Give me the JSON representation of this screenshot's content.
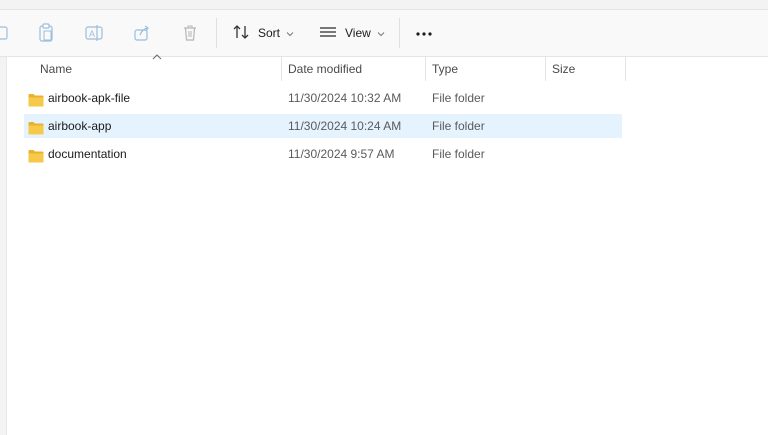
{
  "toolbar": {
    "sort_label": "Sort",
    "view_label": "View",
    "icons": [
      "new-icon",
      "paste-icon",
      "rename-icon",
      "share-icon",
      "delete-icon",
      "sort-icon",
      "view-icon",
      "more-icon"
    ]
  },
  "columns": {
    "name": "Name",
    "date_modified": "Date modified",
    "type": "Type",
    "size": "Size"
  },
  "files": [
    {
      "name": "airbook-apk-file",
      "date_modified": "11/30/2024 10:32 AM",
      "type": "File folder",
      "size": "",
      "selected": false
    },
    {
      "name": "airbook-app",
      "date_modified": "11/30/2024 10:24 AM",
      "type": "File folder",
      "size": "",
      "selected": true
    },
    {
      "name": "documentation",
      "date_modified": "11/30/2024 9:57 AM",
      "type": "File folder",
      "size": "",
      "selected": false
    }
  ],
  "colors": {
    "folder": "#f6c948",
    "selection": "#e5f3ff",
    "accent": "#0067c0"
  }
}
